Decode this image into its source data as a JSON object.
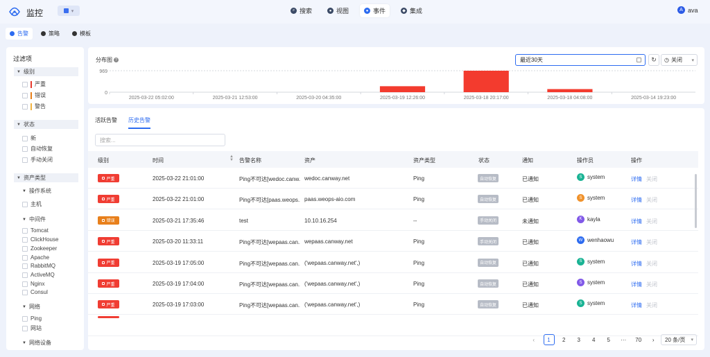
{
  "app": {
    "title": "监控"
  },
  "nav": [
    {
      "label": "搜索",
      "icon": "search-icon"
    },
    {
      "label": "视图",
      "icon": "eye-icon"
    },
    {
      "label": "事件",
      "icon": "bell-icon",
      "active": true
    },
    {
      "label": "集成",
      "icon": "cube-icon"
    }
  ],
  "user": {
    "initial": "A",
    "name": "ava"
  },
  "subtabs": [
    {
      "label": "告警",
      "active": true
    },
    {
      "label": "策略"
    },
    {
      "label": "模板"
    }
  ],
  "filter": {
    "title": "过滤项",
    "level_group": "级别",
    "levels": [
      {
        "label": "严重",
        "color": "#e8382b"
      },
      {
        "label": "错误",
        "color": "#e87e18"
      },
      {
        "label": "警告",
        "color": "#f2b23e"
      }
    ],
    "status_group": "状态",
    "statuses": [
      "新",
      "自动恢复",
      "手动关闭"
    ],
    "asset_group": "资产类型",
    "os_sub": "操作系统",
    "os_items": [
      "主机"
    ],
    "middleware_sub": "中间件",
    "middleware_items": [
      "Tomcat",
      "ClickHouse",
      "Zookeeper",
      "Apache",
      "RabbitMQ",
      "ActiveMQ",
      "Nginx",
      "Consul"
    ],
    "network_sub": "网络",
    "network_items": [
      "Ping",
      "网站"
    ],
    "network_device_sub": "网络设备"
  },
  "chart_header": {
    "title": "分布图",
    "date_range": "最近30天",
    "auto_refresh": "关闭"
  },
  "chart_data": {
    "type": "bar",
    "ylim": [
      0,
      969
    ],
    "yticks": [
      0,
      969
    ],
    "x_labels": [
      "2025-03-22 05:02:00",
      "2025-03-21 12:53:00",
      "2025-03-20 04:35:00",
      "2025-03-19 12:26:00",
      "2025-03-18 20:17:00",
      "2025-03-18 04:08:00",
      "2025-03-14 19:23:00"
    ],
    "categories": [
      "2025-03-22 05:02:00",
      "2025-03-21 12:53:00",
      "2025-03-20 04:35:00",
      "2025-03-19 12:26:00",
      "2025-03-18 20:17:00",
      "2025-03-18 04:08:00",
      "2025-03-14 19:23:00"
    ],
    "values": [
      0,
      0,
      0,
      270,
      969,
      140,
      0
    ],
    "color": "#f33b2e"
  },
  "list": {
    "tabs": [
      {
        "label": "活跃告警"
      },
      {
        "label": "历史告警",
        "active": true
      }
    ],
    "search_placeholder": "搜索...",
    "columns": [
      "级别",
      "时间",
      "告警名称",
      "资产",
      "资产类型",
      "状态",
      "通知",
      "操作员",
      "操作"
    ],
    "rows": [
      {
        "level": "严重",
        "level_color": "#f03d33",
        "time": "2025-03-22 21:01:00",
        "name": "Ping不可达[wedoc.canw...",
        "asset": "wedoc.canway.net",
        "asset_type": "Ping",
        "status": "自动恢复",
        "notify": "已通知",
        "op_initial": "S",
        "op_color": "#1ab394",
        "operator": "system",
        "detail": "详情",
        "close": "关闭"
      },
      {
        "level": "严重",
        "level_color": "#f03d33",
        "time": "2025-03-22 21:01:00",
        "name": "Ping不可达[paas.weops...",
        "asset": "paas.weops-aio.com",
        "asset_type": "Ping",
        "status": "自动恢复",
        "notify": "已通知",
        "op_initial": "S",
        "op_color": "#f0922b",
        "operator": "system",
        "detail": "详情",
        "close": "关闭"
      },
      {
        "level": "错误",
        "level_color": "#e8801c",
        "time": "2025-03-21 17:35:46",
        "name": "test",
        "asset": "10.10.16.254",
        "asset_type": "--",
        "status": "手动关闭",
        "notify": "未通知",
        "op_initial": "K",
        "op_color": "#8159e8",
        "operator": "kayla",
        "detail": "详情",
        "close": "关闭"
      },
      {
        "level": "严重",
        "level_color": "#f03d33",
        "time": "2025-03-20 11:33:11",
        "name": "Ping不可达[wepaas.can...",
        "asset": "wepaas.canway.net",
        "asset_type": "Ping",
        "status": "手动关闭",
        "notify": "已通知",
        "op_initial": "W",
        "op_color": "#2c6bf0",
        "operator": "wenhaowu",
        "detail": "详情",
        "close": "关闭"
      },
      {
        "level": "严重",
        "level_color": "#f03d33",
        "time": "2025-03-19 17:05:00",
        "name": "Ping不可达[wepaas.can...",
        "asset": "('wepaas.canway.net',)",
        "asset_type": "Ping",
        "status": "自动恢复",
        "notify": "已通知",
        "op_initial": "S",
        "op_color": "#1ab394",
        "operator": "system",
        "detail": "详情",
        "close": "关闭"
      },
      {
        "level": "严重",
        "level_color": "#f03d33",
        "time": "2025-03-19 17:04:00",
        "name": "Ping不可达[wepaas.can...",
        "asset": "('wepaas.canway.net',)",
        "asset_type": "Ping",
        "status": "自动恢复",
        "notify": "已通知",
        "op_initial": "S",
        "op_color": "#8159e8",
        "operator": "system",
        "detail": "详情",
        "close": "关闭"
      },
      {
        "level": "严重",
        "level_color": "#f03d33",
        "time": "2025-03-19 17:03:00",
        "name": "Ping不可达[wepaas.can...",
        "asset": "('wepaas.canway.net',)",
        "asset_type": "Ping",
        "status": "自动恢复",
        "notify": "已通知",
        "op_initial": "S",
        "op_color": "#1ab394",
        "operator": "system",
        "detail": "详情",
        "close": "关闭"
      }
    ]
  },
  "pagination": {
    "pages": [
      "1",
      "2",
      "3",
      "4",
      "5",
      "···",
      "70"
    ],
    "current": "1",
    "page_size": "20 条/页"
  }
}
